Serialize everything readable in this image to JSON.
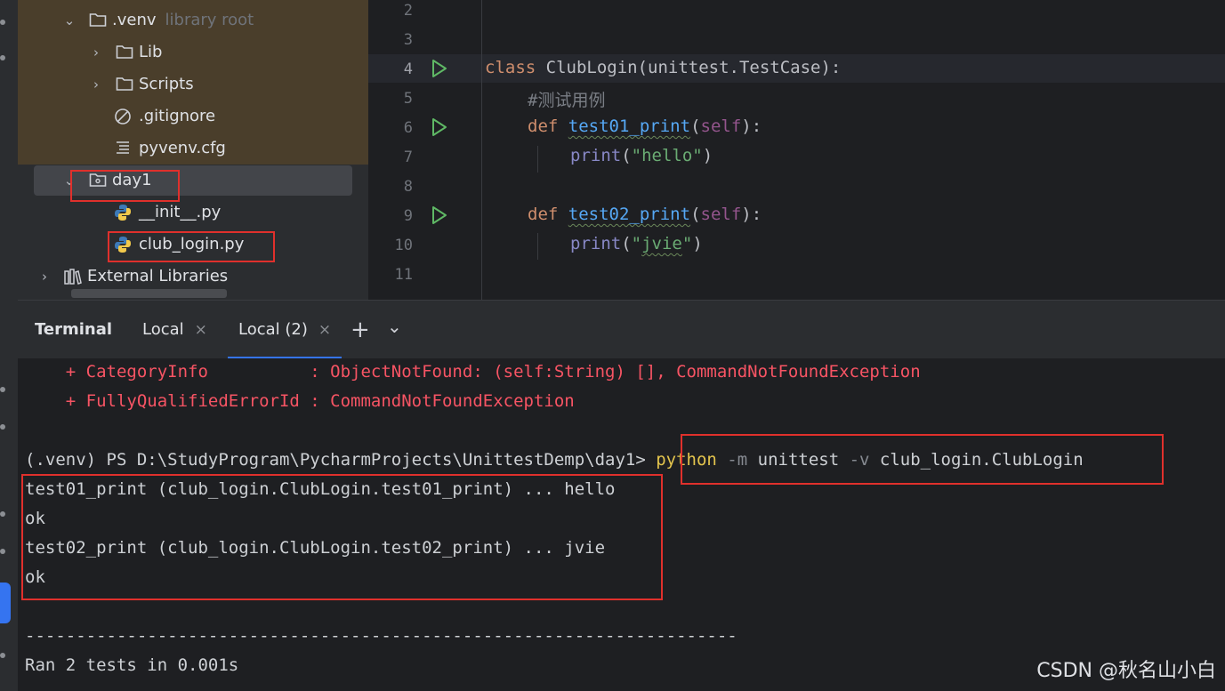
{
  "project_tree": {
    "venv": {
      "name": ".venv",
      "hint": "library root"
    },
    "lib": "Lib",
    "scripts": "Scripts",
    "gitignore": ".gitignore",
    "pyvenv": "pyvenv.cfg",
    "day1": "day1",
    "init": "__init__.py",
    "club_login": "club_login.py",
    "external": "External Libraries"
  },
  "editor": {
    "line_numbers": [
      "2",
      "3",
      "4",
      "5",
      "6",
      "7",
      "8",
      "9",
      "10",
      "11"
    ],
    "class_kw": "class",
    "class_rest": " ClubLogin(unittest.TestCase):",
    "comment": "#测试用例",
    "def_kw": "def",
    "fn1": "test01_print",
    "fn2": "test02_print",
    "self_kw": "self",
    "open_paren": "(",
    "close_sig": "):",
    "print_fn": "print",
    "str1": "\"hello\"",
    "str2_q1": "\"",
    "str2_word": "jvie",
    "str2_q2": "\"",
    "close_paren": ")"
  },
  "terminal_tabs": {
    "title": "Terminal",
    "tab1": "Local",
    "tab2": "Local (2)",
    "close": "×",
    "add": "+",
    "menu": "⌄"
  },
  "terminal": {
    "err1": "    + CategoryInfo          : ObjectNotFound: (self:String) [], CommandNotFoundException",
    "err2": "    + FullyQualifiedErrorId : CommandNotFoundException",
    "prompt": "(.venv) PS D:\\StudyProgram\\PycharmProjects\\UnittestDemp\\day1> ",
    "cmd_python": "python",
    "cmd_m": " -m",
    "cmd_unittest": " unittest",
    "cmd_v": " -v",
    "cmd_target": " club_login.ClubLogin",
    "out1": "test01_print (club_login.ClubLogin.test01_print) ... hello",
    "out2": "ok",
    "out3": "test02_print (club_login.ClubLogin.test02_print) ... jvie",
    "out4": "ok",
    "separator": "----------------------------------------------------------------------",
    "ran": "Ran 2 tests in 0.001s"
  },
  "watermark": "CSDN @秋名山小白",
  "colors": {
    "accent": "#3574f0",
    "highlight_box": "#e0302c",
    "error_text": "#f75464"
  }
}
